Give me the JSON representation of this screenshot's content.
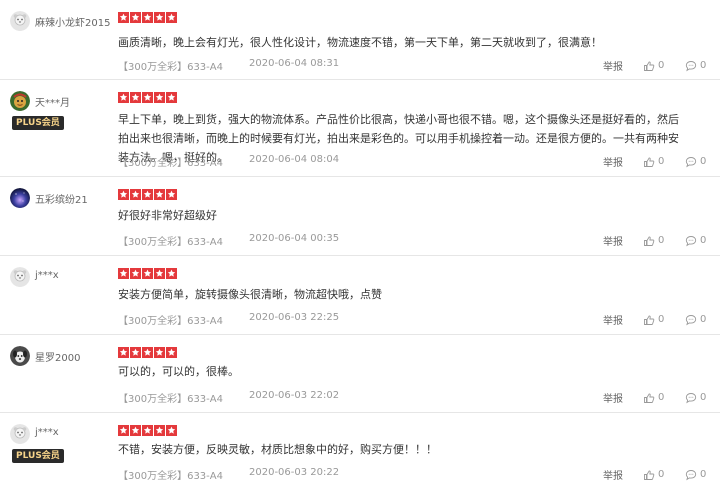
{
  "colors": {
    "star": "#e4393c",
    "badge_bg": "#2a2a2a",
    "badge_text": "#f7d48a"
  },
  "labels": {
    "report": "举报"
  },
  "reviews": [
    {
      "username": "麻辣小龙虾2015",
      "plus": "",
      "rating": 5,
      "content": "画质清晰，晚上会有灯光，很人性化设计，物流速度不错，第一天下单，第二天就收到了，很满意！",
      "product": "【300万全彩】633-A4",
      "date": "2020-06-04 08:31",
      "likes": "0",
      "replies": "0",
      "avatar_icon": "default-avatar-icon"
    },
    {
      "username": "天***月",
      "plus": "PLUS会员",
      "rating": 5,
      "content": "早上下单，晚上到货，强大的物流体系。产品性价比很高，快递小哥也很不错。嗯，这个摄像头还是挺好看的，然后拍出来也很清晰，而晚上的时候要有灯光，拍出来是彩色的。可以用手机操控着一动。还是很方便的。一共有两种安装方法。嗯，挺好的。",
      "product": "【300万全彩】633-A4",
      "date": "2020-06-04 08:04",
      "likes": "0",
      "replies": "0",
      "avatar_icon": "cartoon-avatar-icon"
    },
    {
      "username": "五彩缤纷21",
      "plus": "",
      "rating": 5,
      "content": "好很好非常好超级好",
      "product": "【300万全彩】633-A4",
      "date": "2020-06-04 00:35",
      "likes": "0",
      "replies": "0",
      "avatar_icon": "galaxy-avatar-icon"
    },
    {
      "username": "j***x",
      "plus": "",
      "rating": 5,
      "content": "安装方便简单，旋转摄像头很清晰，物流超快哦，点赞",
      "product": "【300万全彩】633-A4",
      "date": "2020-06-03 22:25",
      "likes": "0",
      "replies": "0",
      "avatar_icon": "default-avatar-icon"
    },
    {
      "username": "星罗2000",
      "plus": "",
      "rating": 5,
      "content": "可以的，可以的，很棒。",
      "product": "【300万全彩】633-A4",
      "date": "2020-06-03 22:02",
      "likes": "0",
      "replies": "0",
      "avatar_icon": "dog-avatar-icon"
    },
    {
      "username": "j***x",
      "plus": "PLUS会员",
      "rating": 5,
      "content": "不错，安装方便，反映灵敏，材质比想象中的好，购买方便！！！",
      "product": "【300万全彩】633-A4",
      "date": "2020-06-03 20:22",
      "likes": "0",
      "replies": "0",
      "avatar_icon": "default-avatar-icon"
    }
  ]
}
